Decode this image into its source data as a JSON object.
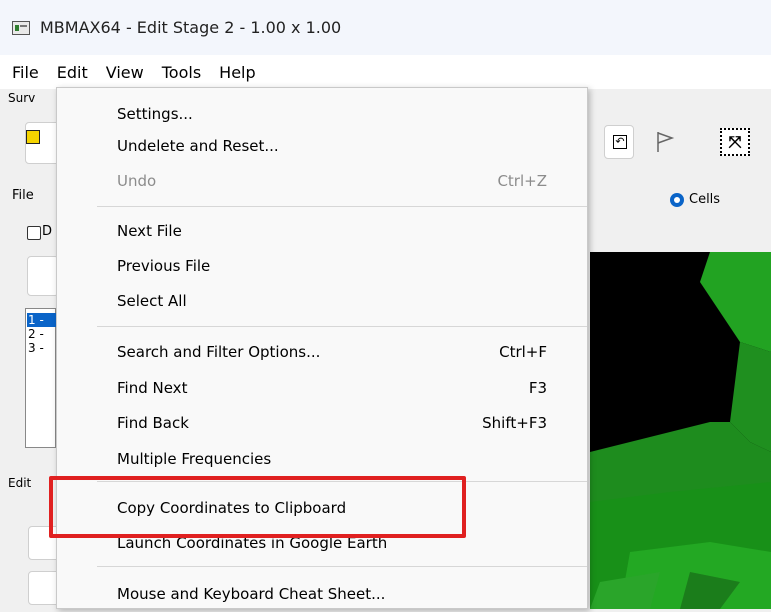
{
  "window": {
    "title": "MBMAX64 - Edit Stage 2 - 1.00 x 1.00"
  },
  "menubar": {
    "items": [
      "File",
      "Edit",
      "View",
      "Tools",
      "Help"
    ]
  },
  "background": {
    "surv_label": "Surv",
    "file_label": "File",
    "d_label": "D",
    "list_items": [
      "1 -",
      "2 -",
      "3 -"
    ],
    "edit_label": "Edit",
    "cells_label": "Cells"
  },
  "dropdown": {
    "items": [
      {
        "label": "Settings...",
        "shortcut": ""
      },
      {
        "label": "Undelete and Reset...",
        "shortcut": ""
      },
      {
        "label": "Undo",
        "shortcut": "Ctrl+Z",
        "disabled": true
      },
      {
        "label": "Next File",
        "shortcut": ""
      },
      {
        "label": "Previous File",
        "shortcut": ""
      },
      {
        "label": "Select All",
        "shortcut": ""
      },
      {
        "label": "Search and Filter Options...",
        "shortcut": "Ctrl+F"
      },
      {
        "label": "Find Next",
        "shortcut": "F3"
      },
      {
        "label": "Find Back",
        "shortcut": "Shift+F3"
      },
      {
        "label": "Multiple Frequencies",
        "shortcut": ""
      },
      {
        "label": "Copy Coordinates to Clipboard",
        "shortcut": ""
      },
      {
        "label": "Launch Coordinates in Google Earth",
        "shortcut": ""
      },
      {
        "label": "Mouse and Keyboard Cheat Sheet...",
        "shortcut": ""
      }
    ]
  },
  "colors": {
    "highlight": "#e02020",
    "accent": "#0a64c8",
    "map_green": "#1e8c1e"
  }
}
